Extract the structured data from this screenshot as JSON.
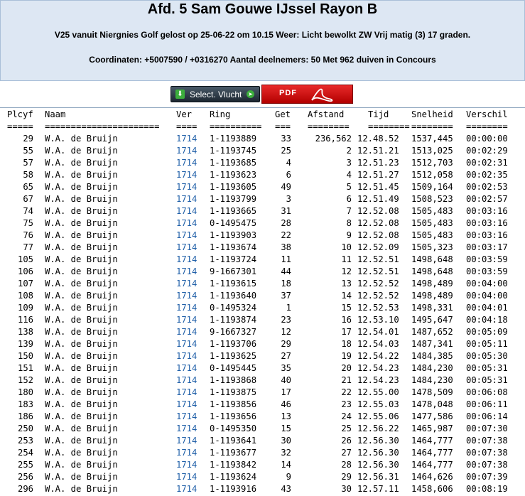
{
  "header": {
    "title": "Afd. 5 Sam Gouwe IJssel Rayon B",
    "line1": "V25 vanuit Niergnies Golf gelost op 25-06-22 om 10.15 Weer: Licht bewolkt ZW Vrij matig (3) 17 graden.",
    "line2": "Coordinaten: +5007590 / +0316270 Aantal deelnemers: 50 Met 962 duiven in Concours"
  },
  "buttons": {
    "select_label": "Select. Vlucht",
    "pdf_label": "PDF"
  },
  "table": {
    "headers": [
      "Plcyf",
      "Naam",
      "Ver",
      "Ring",
      "Get",
      "Afstand",
      "Tijd",
      "Snelheid",
      "Verschil"
    ],
    "underline": [
      "=====",
      "======================",
      "====",
      "==========",
      "===",
      "========",
      "========",
      "========",
      "========"
    ],
    "rows": [
      [
        "29",
        "W.A. de Bruijn",
        "1714",
        "1-1193889",
        "33",
        "236,562",
        "12.48.52",
        "1537,445",
        "00:00:00"
      ],
      [
        "55",
        "W.A. de Bruijn",
        "1714",
        "1-1193745",
        "25",
        "2",
        "12.51.21",
        "1513,025",
        "00:02:29"
      ],
      [
        "57",
        "W.A. de Bruijn",
        "1714",
        "1-1193685",
        "4",
        "3",
        "12.51.23",
        "1512,703",
        "00:02:31"
      ],
      [
        "58",
        "W.A. de Bruijn",
        "1714",
        "1-1193623",
        "6",
        "4",
        "12.51.27",
        "1512,058",
        "00:02:35"
      ],
      [
        "65",
        "W.A. de Bruijn",
        "1714",
        "1-1193605",
        "49",
        "5",
        "12.51.45",
        "1509,164",
        "00:02:53"
      ],
      [
        "67",
        "W.A. de Bruijn",
        "1714",
        "1-1193799",
        "3",
        "6",
        "12.51.49",
        "1508,523",
        "00:02:57"
      ],
      [
        "74",
        "W.A. de Bruijn",
        "1714",
        "1-1193665",
        "31",
        "7",
        "12.52.08",
        "1505,483",
        "00:03:16"
      ],
      [
        "75",
        "W.A. de Bruijn",
        "1714",
        "0-1495475",
        "28",
        "8",
        "12.52.08",
        "1505,483",
        "00:03:16"
      ],
      [
        "76",
        "W.A. de Bruijn",
        "1714",
        "1-1193903",
        "22",
        "9",
        "12.52.08",
        "1505,483",
        "00:03:16"
      ],
      [
        "77",
        "W.A. de Bruijn",
        "1714",
        "1-1193674",
        "38",
        "10",
        "12.52.09",
        "1505,323",
        "00:03:17"
      ],
      [
        "105",
        "W.A. de Bruijn",
        "1714",
        "1-1193724",
        "11",
        "11",
        "12.52.51",
        "1498,648",
        "00:03:59"
      ],
      [
        "106",
        "W.A. de Bruijn",
        "1714",
        "9-1667301",
        "44",
        "12",
        "12.52.51",
        "1498,648",
        "00:03:59"
      ],
      [
        "107",
        "W.A. de Bruijn",
        "1714",
        "1-1193615",
        "18",
        "13",
        "12.52.52",
        "1498,489",
        "00:04:00"
      ],
      [
        "108",
        "W.A. de Bruijn",
        "1714",
        "1-1193640",
        "37",
        "14",
        "12.52.52",
        "1498,489",
        "00:04:00"
      ],
      [
        "109",
        "W.A. de Bruijn",
        "1714",
        "0-1495324",
        "1",
        "15",
        "12.52.53",
        "1498,331",
        "00:04:01"
      ],
      [
        "116",
        "W.A. de Bruijn",
        "1714",
        "1-1193874",
        "23",
        "16",
        "12.53.10",
        "1495,647",
        "00:04:18"
      ],
      [
        "138",
        "W.A. de Bruijn",
        "1714",
        "9-1667327",
        "12",
        "17",
        "12.54.01",
        "1487,652",
        "00:05:09"
      ],
      [
        "139",
        "W.A. de Bruijn",
        "1714",
        "1-1193706",
        "29",
        "18",
        "12.54.03",
        "1487,341",
        "00:05:11"
      ],
      [
        "150",
        "W.A. de Bruijn",
        "1714",
        "1-1193625",
        "27",
        "19",
        "12.54.22",
        "1484,385",
        "00:05:30"
      ],
      [
        "151",
        "W.A. de Bruijn",
        "1714",
        "0-1495445",
        "35",
        "20",
        "12.54.23",
        "1484,230",
        "00:05:31"
      ],
      [
        "152",
        "W.A. de Bruijn",
        "1714",
        "1-1193868",
        "40",
        "21",
        "12.54.23",
        "1484,230",
        "00:05:31"
      ],
      [
        "180",
        "W.A. de Bruijn",
        "1714",
        "1-1193875",
        "17",
        "22",
        "12.55.00",
        "1478,509",
        "00:06:08"
      ],
      [
        "183",
        "W.A. de Bruijn",
        "1714",
        "1-1193856",
        "46",
        "23",
        "12.55.03",
        "1478,048",
        "00:06:11"
      ],
      [
        "186",
        "W.A. de Bruijn",
        "1714",
        "1-1193656",
        "13",
        "24",
        "12.55.06",
        "1477,586",
        "00:06:14"
      ],
      [
        "250",
        "W.A. de Bruijn",
        "1714",
        "0-1495350",
        "15",
        "25",
        "12.56.22",
        "1465,987",
        "00:07:30"
      ],
      [
        "253",
        "W.A. de Bruijn",
        "1714",
        "1-1193641",
        "30",
        "26",
        "12.56.30",
        "1464,777",
        "00:07:38"
      ],
      [
        "254",
        "W.A. de Bruijn",
        "1714",
        "1-1193677",
        "32",
        "27",
        "12.56.30",
        "1464,777",
        "00:07:38"
      ],
      [
        "255",
        "W.A. de Bruijn",
        "1714",
        "1-1193842",
        "14",
        "28",
        "12.56.30",
        "1464,777",
        "00:07:38"
      ],
      [
        "256",
        "W.A. de Bruijn",
        "1714",
        "1-1193624",
        "9",
        "29",
        "12.56.31",
        "1464,626",
        "00:07:39"
      ],
      [
        "296",
        "W.A. de Bruijn",
        "1714",
        "1-1193916",
        "43",
        "30",
        "12.57.11",
        "1458,606",
        "00:08:19"
      ]
    ]
  }
}
